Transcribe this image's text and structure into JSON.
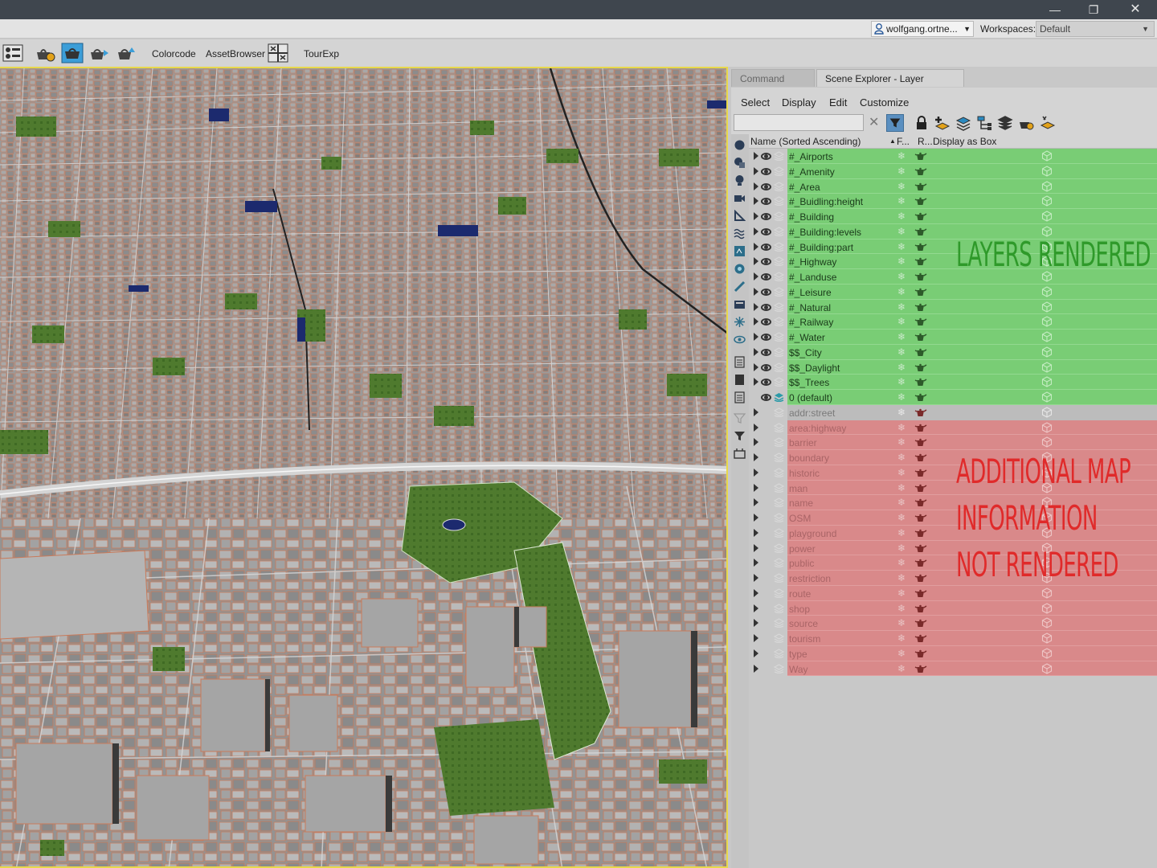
{
  "window": {
    "minimize": "—",
    "restore": "❐",
    "close": "✕"
  },
  "account": {
    "user": "wolfgang.ortne...",
    "workspaces_label": "Workspaces:",
    "workspace": "Default"
  },
  "toolbar": {
    "items": [
      "Colorcode",
      "AssetBrowser",
      "TourExp"
    ]
  },
  "panel": {
    "tabs": [
      "Command Panel",
      "Scene Explorer - Layer Explorer"
    ],
    "menu": [
      "Select",
      "Display",
      "Edit",
      "Customize"
    ],
    "search_placeholder": "",
    "columns": {
      "name": "Name (Sorted Ascending)",
      "freeze": "F...",
      "render": "R...",
      "box": "Display as Box"
    }
  },
  "layers": [
    {
      "name": "#_Airports",
      "state": "green"
    },
    {
      "name": "#_Amenity",
      "state": "green"
    },
    {
      "name": "#_Area",
      "state": "green"
    },
    {
      "name": "#_Buidling:height",
      "state": "green"
    },
    {
      "name": "#_Building",
      "state": "green"
    },
    {
      "name": "#_Building:levels",
      "state": "green"
    },
    {
      "name": "#_Building:part",
      "state": "green"
    },
    {
      "name": "#_Highway",
      "state": "green"
    },
    {
      "name": "#_Landuse",
      "state": "green"
    },
    {
      "name": "#_Leisure",
      "state": "green"
    },
    {
      "name": "#_Natural",
      "state": "green"
    },
    {
      "name": "#_Railway",
      "state": "green"
    },
    {
      "name": "#_Water",
      "state": "green"
    },
    {
      "name": "$$_City",
      "state": "green"
    },
    {
      "name": "$$_Daylight",
      "state": "green"
    },
    {
      "name": "$$_Trees",
      "state": "green"
    },
    {
      "name": "0 (default)",
      "state": "green",
      "default": true
    },
    {
      "name": "addr:street",
      "state": "gray"
    },
    {
      "name": "area:highway",
      "state": "red"
    },
    {
      "name": "barrier",
      "state": "red"
    },
    {
      "name": "boundary",
      "state": "red"
    },
    {
      "name": "historic",
      "state": "red"
    },
    {
      "name": "man",
      "state": "red"
    },
    {
      "name": "name",
      "state": "red"
    },
    {
      "name": "OSM",
      "state": "red"
    },
    {
      "name": "playground",
      "state": "red"
    },
    {
      "name": "power",
      "state": "red"
    },
    {
      "name": "public",
      "state": "red"
    },
    {
      "name": "restriction",
      "state": "red"
    },
    {
      "name": "route",
      "state": "red"
    },
    {
      "name": "shop",
      "state": "red"
    },
    {
      "name": "source",
      "state": "red"
    },
    {
      "name": "tourism",
      "state": "red"
    },
    {
      "name": "type",
      "state": "red"
    },
    {
      "name": "Way",
      "state": "red"
    }
  ],
  "annotations": {
    "rendered": "LAYERS RENDERED",
    "not_rendered_1": "ADDITIONAL MAP",
    "not_rendered_2": "INFORMATION",
    "not_rendered_3": "NOT RENDERED"
  },
  "colors": {
    "rendered": "#79cd75",
    "not_rendered": "#d9898a",
    "viewport_border": "#e8d84a"
  }
}
